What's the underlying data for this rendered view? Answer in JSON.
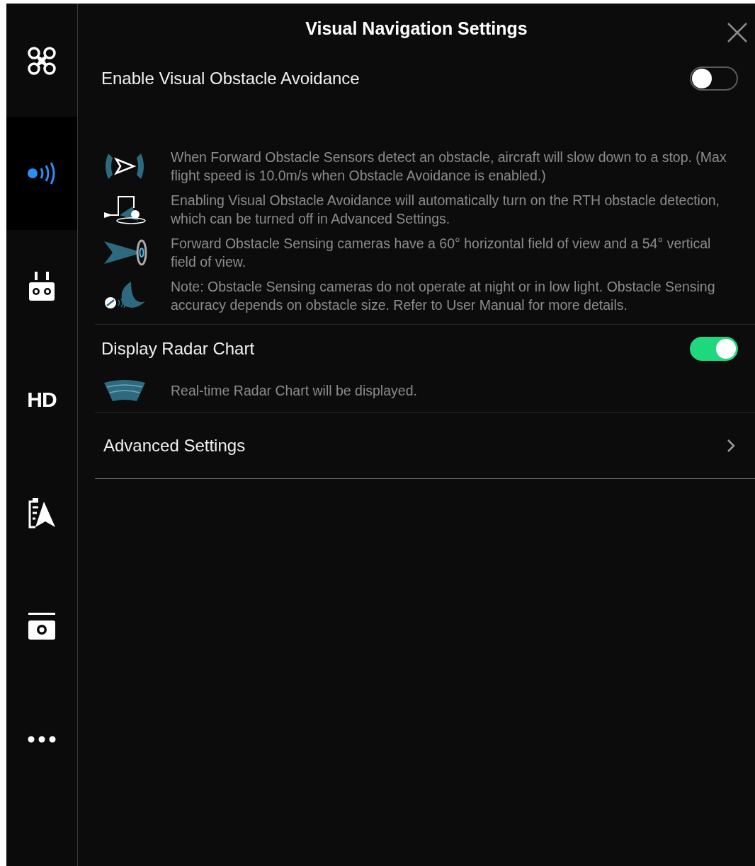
{
  "sidebar": {
    "items": [
      {
        "kind": "drone",
        "selected": false
      },
      {
        "kind": "sensors",
        "selected": true
      },
      {
        "kind": "remote",
        "selected": false
      },
      {
        "kind": "hd",
        "label": "HD",
        "selected": false
      },
      {
        "kind": "battery",
        "selected": false
      },
      {
        "kind": "camera",
        "selected": false
      },
      {
        "kind": "more",
        "selected": false
      }
    ]
  },
  "header": {
    "title": "Visual Navigation Settings"
  },
  "sections": [
    {
      "label": "Enable Visual Obstacle Avoidance",
      "on": false,
      "notes": [
        {
          "kind": "forward",
          "text": "When Forward Obstacle Sensors detect an obstacle, aircraft will slow down to a stop. (Max flight speed is 10.0m/s when Obstacle Avoidance is enabled.)"
        },
        {
          "kind": "rth",
          "text": "Enabling Visual Obstacle Avoidance will automatically turn on the RTH obstacle detection, which can be turned off in Advanced Settings."
        },
        {
          "kind": "fov",
          "text": "Forward Obstacle Sensing cameras have a 60° horizontal field of view and a 54° vertical field of view."
        },
        {
          "kind": "night",
          "text": "Note: Obstacle Sensing cameras do not operate at night or in low light. Obstacle Sensing accuracy depends on obstacle size. Refer to User Manual for more details."
        }
      ]
    },
    {
      "label": "Display Radar Chart",
      "on": true,
      "notes": [
        {
          "kind": "radar",
          "text": "Real-time Radar Chart will be displayed."
        }
      ]
    }
  ],
  "advanced": {
    "label": "Advanced Settings"
  }
}
